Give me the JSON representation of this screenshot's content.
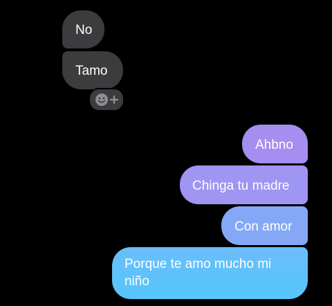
{
  "conversation": {
    "incoming": [
      {
        "text": "No"
      },
      {
        "text": "Tamo"
      }
    ],
    "reaction": {
      "icon": "smiley-icon",
      "add_icon": "plus-icon"
    },
    "outgoing": [
      {
        "text": "Ahbno"
      },
      {
        "text": "Chinga tu madre"
      },
      {
        "text": "Con amor"
      },
      {
        "text": "Porque te amo mucho mi niño"
      }
    ]
  },
  "colors": {
    "background": "#000000",
    "incoming_bubble": "#3c3c3e",
    "outgoing_purple": "#a58ef0",
    "outgoing_blue": "#55c6fb",
    "text": "#ffffff"
  }
}
